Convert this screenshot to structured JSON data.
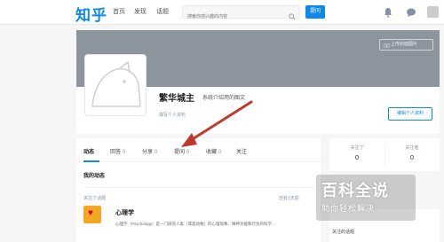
{
  "colors": {
    "brand": "#0f88eb",
    "cover": "#8c959d",
    "arrow": "#c0392b",
    "topic_icon": "#f5a623"
  },
  "header": {
    "logo": "知乎",
    "nav": [
      "首页",
      "发现",
      "话题"
    ],
    "search_placeholder": "搜索你感兴趣的内容",
    "ask_label": "提问",
    "icons": [
      "search-icon",
      "bell-icon",
      "message-icon"
    ]
  },
  "profile": {
    "cover_button_label": "上传封面图片",
    "name": "繁华城主",
    "headline": "系统介绍用的图文",
    "edit_link": "填写个人资料",
    "edit_button_label": "编辑个人资料"
  },
  "tabs": [
    {
      "label": "动态",
      "count": ""
    },
    {
      "label": "回答",
      "count": "0"
    },
    {
      "label": "分享",
      "count": "0"
    },
    {
      "label": "提问",
      "count": "0"
    },
    {
      "label": "收藏",
      "count": "0"
    },
    {
      "label": "关注",
      "count": ""
    }
  ],
  "feed": {
    "section_title": "我的动态",
    "item_meta": "关注了话题",
    "item_time": "还有1天前",
    "topic_title": "心理学",
    "topic_desc": "心理学（Psychology）是一门研究人类（或是动物）的心理现象、精神功能和行为的科学..."
  },
  "side": {
    "stats": [
      {
        "label": "关注了",
        "value": "0"
      },
      {
        "label": "关注者",
        "value": "0"
      }
    ],
    "box_title": "关注的话题"
  },
  "watermark": {
    "main": "百科全说",
    "sub": "助你轻松解决"
  }
}
